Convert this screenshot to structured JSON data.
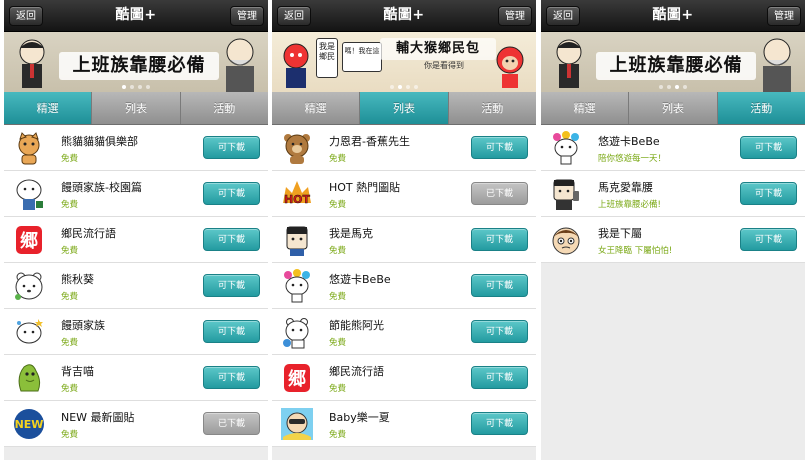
{
  "colors": {
    "accent": "#2ba3a8",
    "subtitle_green": "#7aa815",
    "topbar": "#1e1e1e",
    "tab_bg": "#a3a3a3",
    "disabled": "#a9a9a9"
  },
  "screens": [
    {
      "topbar": {
        "back": "返回",
        "title": "酷圖+",
        "manage": "管理"
      },
      "banner": {
        "slogan": "上班族靠腰必備"
      },
      "tabs": [
        "精選",
        "列表",
        "活動"
      ],
      "active_tab": 0,
      "items": [
        {
          "name": "熊貓貓貓俱樂部",
          "sub": "免費",
          "button": "可下載",
          "icon": "cat-sticker-icon"
        },
        {
          "name": "饅頭家族-校園篇",
          "sub": "免費",
          "button": "可下載",
          "icon": "bun-student-sticker-icon"
        },
        {
          "name": "鄉民流行語",
          "sub": "免費",
          "button": "可下載",
          "icon": "xiang-character-icon"
        },
        {
          "name": "熊秋葵",
          "sub": "免費",
          "button": "可下載",
          "icon": "white-bear-sticker-icon"
        },
        {
          "name": "饅頭家族",
          "sub": "免費",
          "button": "可下載",
          "icon": "bun-sticker-icon"
        },
        {
          "name": "背吉喵",
          "sub": "免費",
          "button": "可下載",
          "icon": "green-monster-sticker-icon"
        },
        {
          "name": "NEW 最新圖貼",
          "sub": "免費",
          "button": "已下載",
          "icon": "new-badge-icon"
        }
      ]
    },
    {
      "topbar": {
        "back": "返回",
        "title": "酷圖+",
        "manage": "管理"
      },
      "banner": {
        "slogan": "輔大猴鄉民包",
        "bubble_a": "我是鄉民",
        "bubble_b": "嗎！我在這",
        "sub": "你是看得到"
      },
      "tabs": [
        "精選",
        "列表",
        "活動"
      ],
      "active_tab": 1,
      "items": [
        {
          "name": "力恩君-香蕉先生",
          "sub": "免費",
          "button": "可下載",
          "icon": "brown-bear-sticker-icon"
        },
        {
          "name": "HOT 熱門圖貼",
          "sub": "免費",
          "button": "已下載",
          "icon": "hot-badge-icon"
        },
        {
          "name": "我是馬克",
          "sub": "免費",
          "button": "可下載",
          "icon": "mark-face-icon"
        },
        {
          "name": "悠遊卡BeBe",
          "sub": "免費",
          "button": "可下載",
          "icon": "bebe-sticker-icon"
        },
        {
          "name": "節能熊阿光",
          "sub": "免費",
          "button": "可下載",
          "icon": "polar-bear-sticker-icon"
        },
        {
          "name": "鄉民流行語",
          "sub": "免費",
          "button": "可下載",
          "icon": "xiang-character-icon"
        },
        {
          "name": "Baby樂一夏",
          "sub": "免費",
          "button": "可下載",
          "icon": "baby-summer-sticker-icon"
        }
      ]
    },
    {
      "topbar": {
        "back": "返回",
        "title": "酷圖+",
        "manage": "管理"
      },
      "banner": {
        "slogan": "上班族靠腰必備"
      },
      "tabs": [
        "精選",
        "列表",
        "活動"
      ],
      "active_tab": 2,
      "items": [
        {
          "name": "悠遊卡BeBe",
          "sub": "陪你悠遊每一天！",
          "button": "可下載",
          "icon": "bebe-sticker-icon"
        },
        {
          "name": "馬克愛靠腰",
          "sub": "上班族靠腰必備!",
          "button": "可下載",
          "icon": "mark-phone-sticker-icon"
        },
        {
          "name": "我是下屬",
          "sub": "女王降臨 下屬怕怕!",
          "button": "可下載",
          "icon": "subordinate-face-icon"
        }
      ]
    }
  ]
}
